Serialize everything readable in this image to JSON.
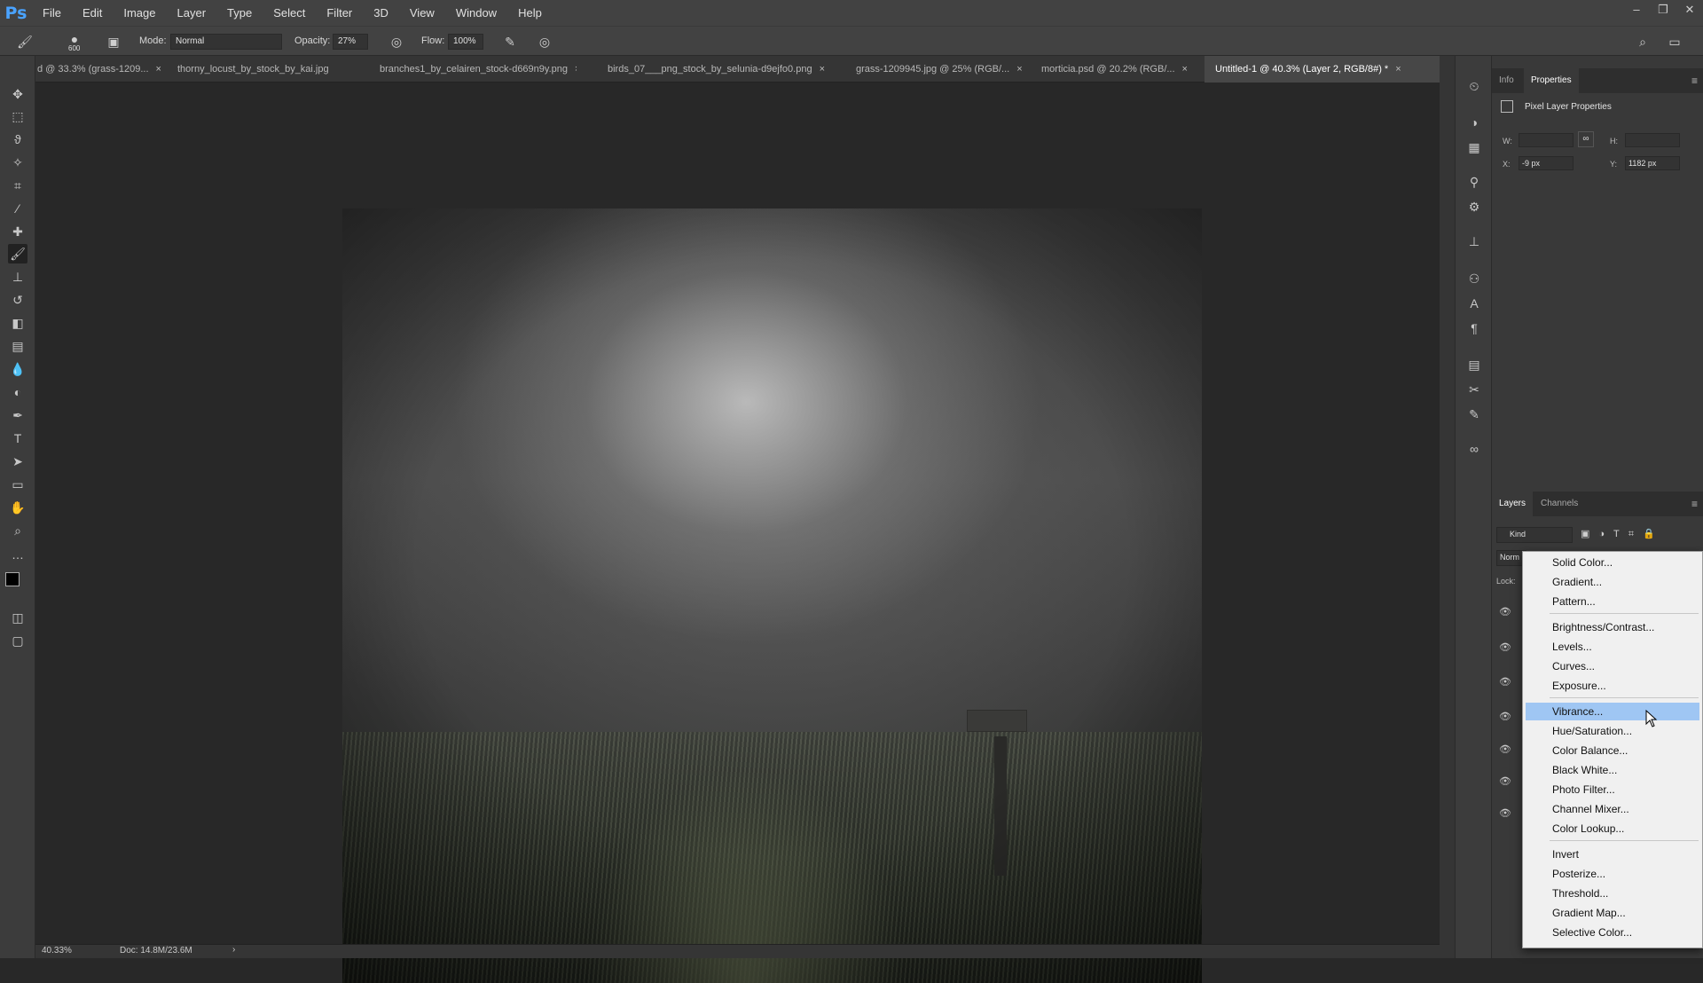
{
  "app": {
    "logo": "Ps"
  },
  "menu": [
    "File",
    "Edit",
    "Image",
    "Layer",
    "Type",
    "Select",
    "Filter",
    "3D",
    "View",
    "Window",
    "Help"
  ],
  "window_controls": [
    "–",
    "❐",
    "✕"
  ],
  "options": {
    "brush_size": "600",
    "mode_label": "Mode:",
    "mode_value": "Normal",
    "opacity_label": "Opacity:",
    "opacity_value": "27%",
    "flow_label": "Flow:",
    "flow_value": "100%"
  },
  "tabs": [
    {
      "label": "d @ 33.3% (grass-1209...",
      "close": "×"
    },
    {
      "label": "thorny_locust_by_stock_by_kai.jpg ...",
      "close": "×"
    },
    {
      "label": "branches1_by_celairen_stock-d669n9y.png",
      "close": "×"
    },
    {
      "label": "birds_07___png_stock_by_selunia-d9ejfo0.png",
      "close": "×"
    },
    {
      "label": "grass-1209945.jpg @ 25% (RGB/...",
      "close": "×"
    },
    {
      "label": "morticia.psd @ 20.2% (RGB/...",
      "close": "×"
    },
    {
      "label": "Untitled-1 @ 40.3% (Layer 2, RGB/8#) *",
      "close": "×"
    }
  ],
  "status": {
    "zoom": "40.33%",
    "doc": "Doc: 14.8M/23.6M",
    "arrow": "›"
  },
  "properties_panel": {
    "tabs": [
      "Info",
      "Properties"
    ],
    "section_title": "Pixel Layer Properties",
    "w_label": "W:",
    "h_label": "H:",
    "w_value": "",
    "h_value": "",
    "x_label": "X:",
    "x_value": "-9 px",
    "y_label": "Y:",
    "y_value": "1182 px"
  },
  "layers_panel": {
    "tabs": [
      "Layers",
      "Channels"
    ],
    "filter_value": "Kind",
    "blend_value": "Norm",
    "lock_label": "Lock:"
  },
  "adjustment_menu": {
    "group1": [
      "Solid Color...",
      "Gradient...",
      "Pattern..."
    ],
    "group2": [
      "Brightness/Contrast...",
      "Levels...",
      "Curves...",
      "Exposure..."
    ],
    "group3": [
      "Vibrance...",
      "Hue/Saturation...",
      "Color Balance...",
      "Black  White...",
      "Photo Filter...",
      "Channel Mixer...",
      "Color Lookup..."
    ],
    "group4": [
      "Invert",
      "Posterize...",
      "Threshold...",
      "Gradient Map...",
      "Selective Color..."
    ],
    "highlighted": "Vibrance..."
  },
  "colors": {
    "accent_highlight": "#9fc6f3",
    "ps_blue": "#4aa3ff"
  }
}
